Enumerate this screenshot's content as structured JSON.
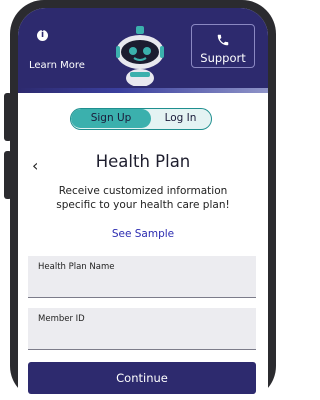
{
  "header": {
    "info_icon": "info-icon",
    "learn_more_label": "Learn More",
    "support_label": "Support",
    "support_icon": "phone-icon",
    "mascot_icon": "robot-mascot-icon",
    "background_color": "#2d2a6e"
  },
  "auth_toggle": {
    "sign_up_label": "Sign Up",
    "log_in_label": "Log In",
    "active": "Sign Up",
    "accent_color": "#3bb0ad"
  },
  "page": {
    "back_symbol": "‹",
    "title": "Health Plan",
    "description": "Receive customized information specific to your health care plan!",
    "see_sample_label": "See Sample"
  },
  "form": {
    "fields": [
      {
        "label": "Health Plan Name",
        "value": ""
      },
      {
        "label": "Member ID",
        "value": ""
      }
    ],
    "continue_label": "Continue"
  }
}
